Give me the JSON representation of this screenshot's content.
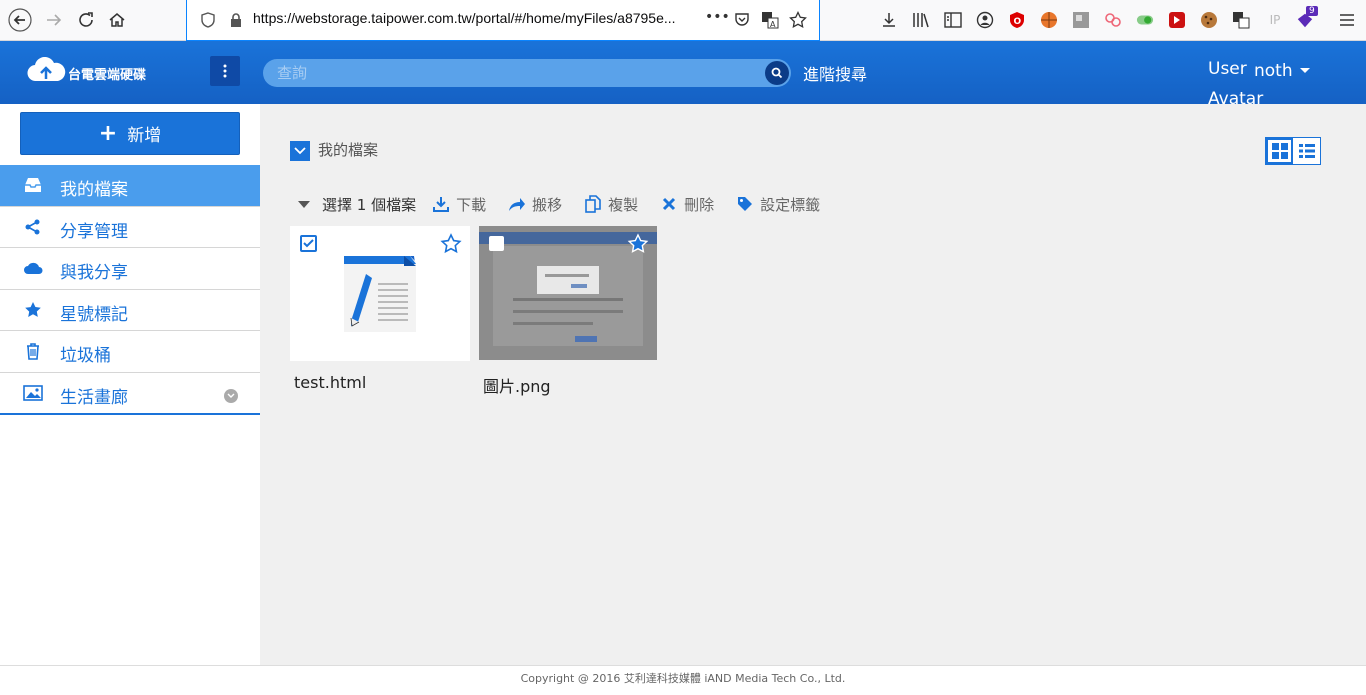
{
  "browser": {
    "url": "https://webstorage.taipower.com.tw/portal/#/home/myFiles/a8795e...",
    "more_dots": "•••",
    "ext_badge": "9",
    "ext_ip": "IP"
  },
  "header": {
    "logo_text": "台電雲端硬碟",
    "search_placeholder": "查詢",
    "advanced_search": "進階搜尋",
    "user_label": "User",
    "user_name": "noth",
    "avatar_label": "Avatar"
  },
  "sidebar": {
    "new_label": "新增",
    "items": [
      {
        "label": "我的檔案",
        "icon": "inbox-icon",
        "active": true
      },
      {
        "label": "分享管理",
        "icon": "share-icon"
      },
      {
        "label": "與我分享",
        "icon": "cloud-icon"
      },
      {
        "label": "星號標記",
        "icon": "star-icon"
      },
      {
        "label": "垃圾桶",
        "icon": "trash-icon"
      },
      {
        "label": "生活畫廊",
        "icon": "image-icon"
      }
    ]
  },
  "main": {
    "breadcrumb": "我的檔案",
    "selection": "選擇 1 個檔案",
    "actions": [
      {
        "label": "下載",
        "icon": "download-icon"
      },
      {
        "label": "搬移",
        "icon": "move-icon"
      },
      {
        "label": "複製",
        "icon": "copy-icon"
      },
      {
        "label": "刪除",
        "icon": "delete-icon"
      },
      {
        "label": "設定標籤",
        "icon": "tag-icon"
      }
    ],
    "files": [
      {
        "name": "test.html",
        "checked": true,
        "starred": false,
        "type": "document"
      },
      {
        "name": "圖片.png",
        "checked": false,
        "starred": true,
        "type": "image"
      }
    ]
  },
  "footer": {
    "copyright": "Copyright @ 2016 艾利達科技媒體 iAND Media Tech Co., Ltd."
  },
  "colors": {
    "brand_blue": "#1a73d9",
    "active_item": "#4a9ded",
    "main_bg": "#f0f0f0"
  }
}
